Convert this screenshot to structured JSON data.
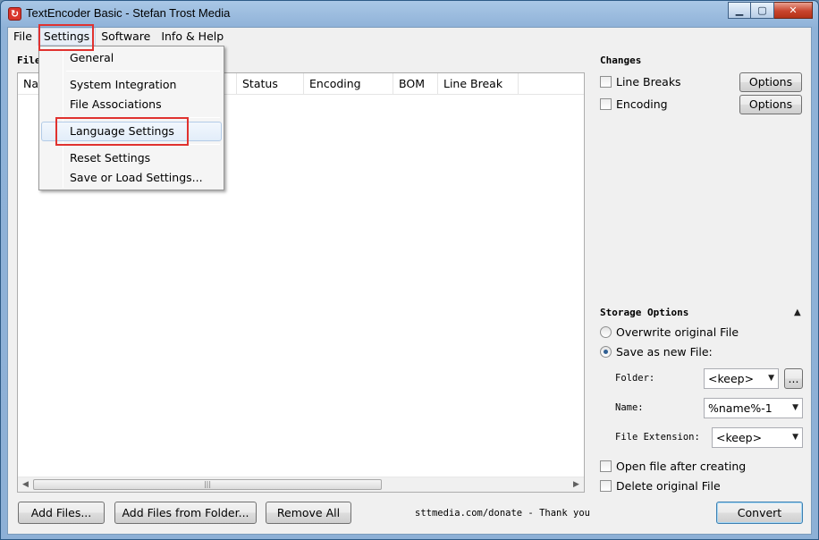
{
  "window": {
    "title": "TextEncoder Basic - Stefan Trost Media"
  },
  "menubar": {
    "file": "File",
    "settings": "Settings",
    "software": "Software",
    "info": "Info & Help"
  },
  "settings_menu": {
    "general": "General",
    "system_integration": "System Integration",
    "file_associations": "File Associations",
    "language_settings": "Language Settings",
    "reset_settings": "Reset Settings",
    "save_load": "Save or Load Settings..."
  },
  "files": {
    "label": "File",
    "columns": {
      "name": "Na",
      "status": "Status",
      "encoding": "Encoding",
      "bom": "BOM",
      "line_break": "Line Break"
    }
  },
  "changes": {
    "title": "Changes",
    "line_breaks": "Line Breaks",
    "encoding": "Encoding",
    "options_label": "Options"
  },
  "storage": {
    "title": "Storage Options",
    "overwrite": "Overwrite original File",
    "save_new": "Save as new File:",
    "folder_label": "Folder:",
    "folder_value": "<keep>",
    "browse": "...",
    "name_label": "Name:",
    "name_value": "%name%-1",
    "ext_label": "File Extension:",
    "ext_value": "<keep>",
    "open_after": "Open file after creating",
    "delete_original": "Delete original File"
  },
  "bottom": {
    "add_files": "Add Files...",
    "add_folder": "Add Files from Folder...",
    "remove_all": "Remove All",
    "donate": "sttmedia.com/donate - Thank you",
    "convert": "Convert"
  }
}
